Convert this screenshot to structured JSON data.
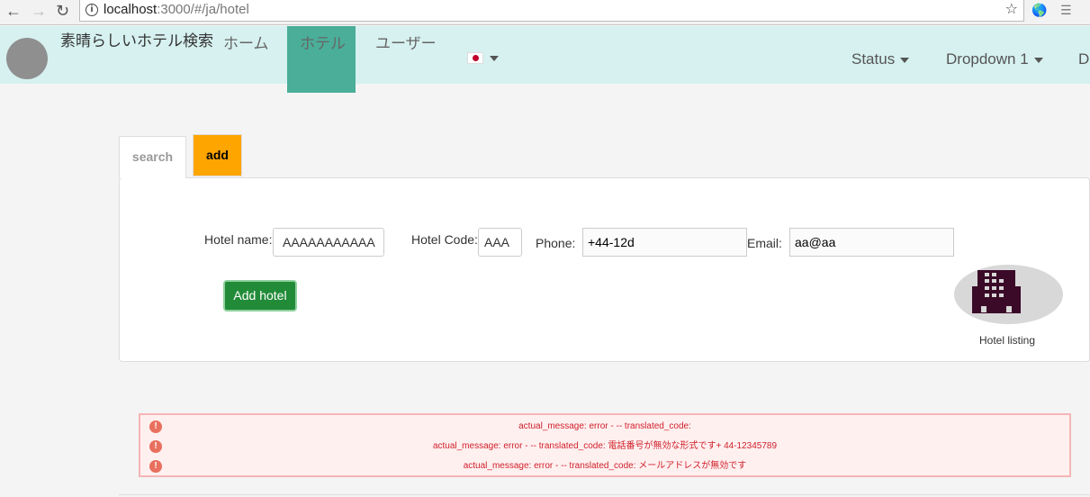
{
  "browser": {
    "url_host": "localhost",
    "url_rest": ":3000/#/ja/hotel"
  },
  "navbar": {
    "brand": "素晴らしいホテル検索",
    "items": [
      {
        "label": "ホーム"
      },
      {
        "label": "ホテル",
        "active": true
      },
      {
        "label": "ユーザー"
      }
    ],
    "language_flag": "japan-flag-icon",
    "right_items": [
      {
        "label": "Status"
      },
      {
        "label": "Dropdown 1"
      },
      {
        "label": "D"
      }
    ],
    "active_color": "#4aae99",
    "background": "#d6f1ef"
  },
  "tabs": [
    {
      "label": "search"
    },
    {
      "label": "add",
      "active": true
    }
  ],
  "form": {
    "hotel_name": {
      "label": "Hotel name:",
      "value": "AAAAAAAAAAA"
    },
    "hotel_code": {
      "label": "Hotel Code:",
      "value": "AAA"
    },
    "phone": {
      "label": "Phone:",
      "value": "+44-12d"
    },
    "email": {
      "label": "Email:",
      "value": "aa@aa"
    },
    "submit_label": "Add hotel"
  },
  "hotel_listing": {
    "label": "Hotel listing",
    "icon": "building-icon"
  },
  "alerts": [
    {
      "text": "actual_message: error - -- translated_code:"
    },
    {
      "text": "actual_message: error - -- translated_code: 電話番号が無効な形式です+ 44-12345789"
    },
    {
      "text": "actual_message: error - -- translated_code: メールアドレスが無効です"
    }
  ]
}
